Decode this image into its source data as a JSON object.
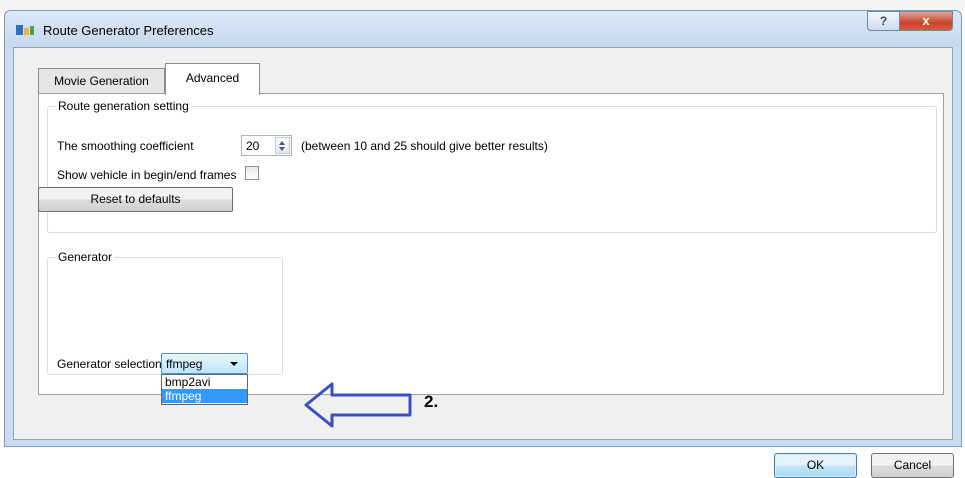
{
  "window": {
    "title": "Route Generator Preferences",
    "help_glyph": "?",
    "close_glyph": "x"
  },
  "tabs": [
    {
      "label": "Movie Generation",
      "active": false
    },
    {
      "label": "Advanced",
      "active": true
    }
  ],
  "route_group": {
    "title": "Route generation setting",
    "smoothing_label": "The smoothing coefficient",
    "smoothing_value": "20",
    "smoothing_hint": "(between 10 and 25 should give better results)",
    "show_vehicle_label": "Show vehicle in begin/end frames",
    "show_vehicle_checked": false,
    "reset_button": "Reset to defaults"
  },
  "generator_group": {
    "title": "Generator",
    "selection_label": "Generator selection",
    "selected_value": "ffmpeg",
    "options": [
      "bmp2avi",
      "ffmpeg"
    ],
    "highlighted_option": "ffmpeg"
  },
  "annotation": {
    "label": "2.",
    "arrow_color": "#3b4fc4"
  },
  "buttons": {
    "ok": "OK",
    "cancel": "Cancel"
  },
  "colors": {
    "selection_highlight": "#3399ff",
    "titlebar": "#c9dcf1",
    "close_button": "#c6452e"
  }
}
